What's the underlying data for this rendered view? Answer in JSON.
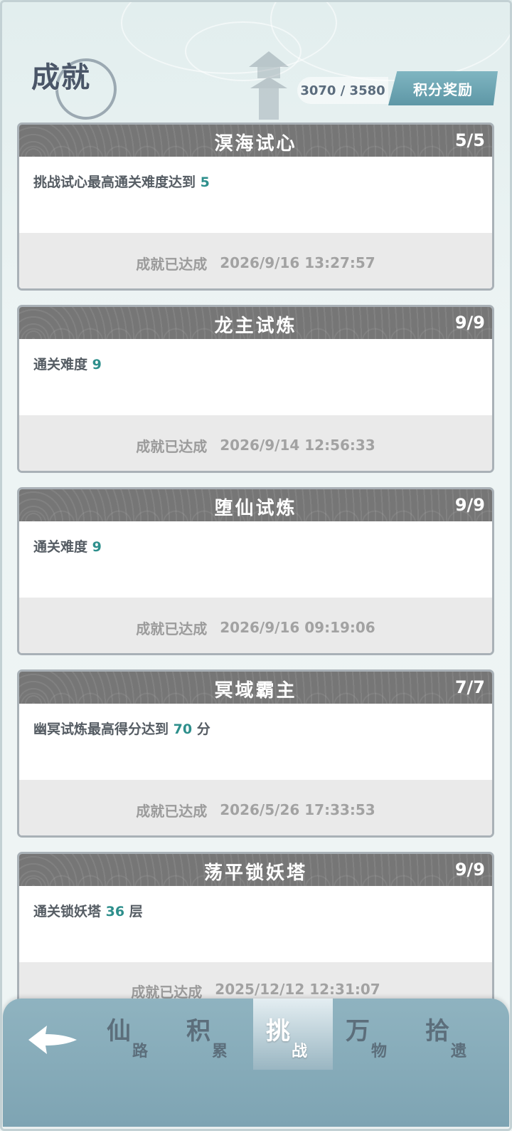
{
  "header": {
    "title": "成就",
    "score_current": "3070",
    "score_sep": " / ",
    "score_total": "3580",
    "reward_button": "积分奖励"
  },
  "achievements": [
    {
      "title": "溟海试心",
      "count": "5/5",
      "desc_prefix": "挑战试心最高通关难度达到 ",
      "desc_num": "5",
      "desc_suffix": "",
      "status": "成就已达成",
      "date": "2026/9/16 13:27:57"
    },
    {
      "title": "龙主试炼",
      "count": "9/9",
      "desc_prefix": "通关难度 ",
      "desc_num": "9",
      "desc_suffix": "",
      "status": "成就已达成",
      "date": "2026/9/14 12:56:33"
    },
    {
      "title": "堕仙试炼",
      "count": "9/9",
      "desc_prefix": "通关难度 ",
      "desc_num": "9",
      "desc_suffix": "",
      "status": "成就已达成",
      "date": "2026/9/16 09:19:06"
    },
    {
      "title": "冥域霸主",
      "count": "7/7",
      "desc_prefix": "幽冥试炼最高得分达到 ",
      "desc_num": "70",
      "desc_suffix": " 分",
      "status": "成就已达成",
      "date": "2026/5/26 17:33:53"
    },
    {
      "title": "荡平锁妖塔",
      "count": "9/9",
      "desc_prefix": "通关锁妖塔 ",
      "desc_num": "36",
      "desc_suffix": " 层",
      "status": "成就已达成",
      "date": "2025/12/12 12:31:07"
    }
  ],
  "nav": {
    "back_icon": "back-arrow-icon",
    "tabs": [
      {
        "big": "仙",
        "small": "路",
        "active": false
      },
      {
        "big": "积",
        "small": "累",
        "active": false
      },
      {
        "big": "挑",
        "small": "战",
        "active": true
      },
      {
        "big": "万",
        "small": "物",
        "active": false
      },
      {
        "big": "拾",
        "small": "遗",
        "active": false
      }
    ]
  },
  "colors": {
    "accent": "#2e8f8c",
    "card_head": "#767676",
    "nav_bg": "#8fb3c0",
    "reward_btn": "#6aa5b3"
  }
}
